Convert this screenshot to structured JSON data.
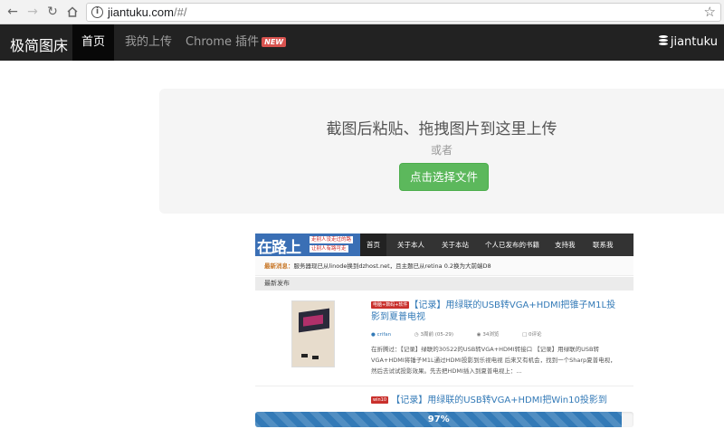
{
  "browser": {
    "url_host": "jiantuku.com",
    "url_path": "/#/"
  },
  "site": {
    "brand": "极简图床",
    "nav": [
      "首页",
      "我的上传",
      "Chrome 插件"
    ],
    "nav_badge": "NEW",
    "user": "jiantuku"
  },
  "upload": {
    "title": "截图后粘贴、拖拽图片到这里上传",
    "or": "或者",
    "button": "点击选择文件"
  },
  "preview": {
    "logo": "在路上",
    "slogan_line1": "走别人没走过的路",
    "slogan_line2": "让别人有路可走",
    "nav": [
      "首页",
      "关于本人",
      "关于本站",
      "个人已发布的书籍",
      "支持我",
      "联系我"
    ],
    "notice_label": "最新消息：",
    "notice_text": "服务器现已从linode换到dzhost.net，且主题已从retina 0.2换为大前端D8",
    "section": "最新发布",
    "post1": {
      "tag": "电脑+数码+软件",
      "title": "【记录】用绿联的USB转VGA+HDMI把锥子M1L投影到夏普电视",
      "author": "crifan",
      "time": "3周前 (05-29)",
      "views": "34浏览",
      "comments": "0评论",
      "excerpt": "在折腾过：【记录】绿联的30522的USB转VGA+HDMI转接口 【记录】用绿联的USB转VGA+HDMI将锤子M1L通过HDMI投影到乐视电视 后来又有机会，找到一个Sharp夏普电视，然后去试试投影效果。先去把HDMI插入到夏普电视上：..."
    },
    "post2": {
      "tag": "win10",
      "title": "【记录】用绿联的USB转VGA+HDMI把Win10投影到"
    }
  },
  "progress": {
    "label": "97%",
    "value": 0.97
  },
  "colors": {
    "navbar": "#222222",
    "upload_button": "#5cb85c",
    "progress": "#337ab7",
    "badge": "#d9534f"
  }
}
